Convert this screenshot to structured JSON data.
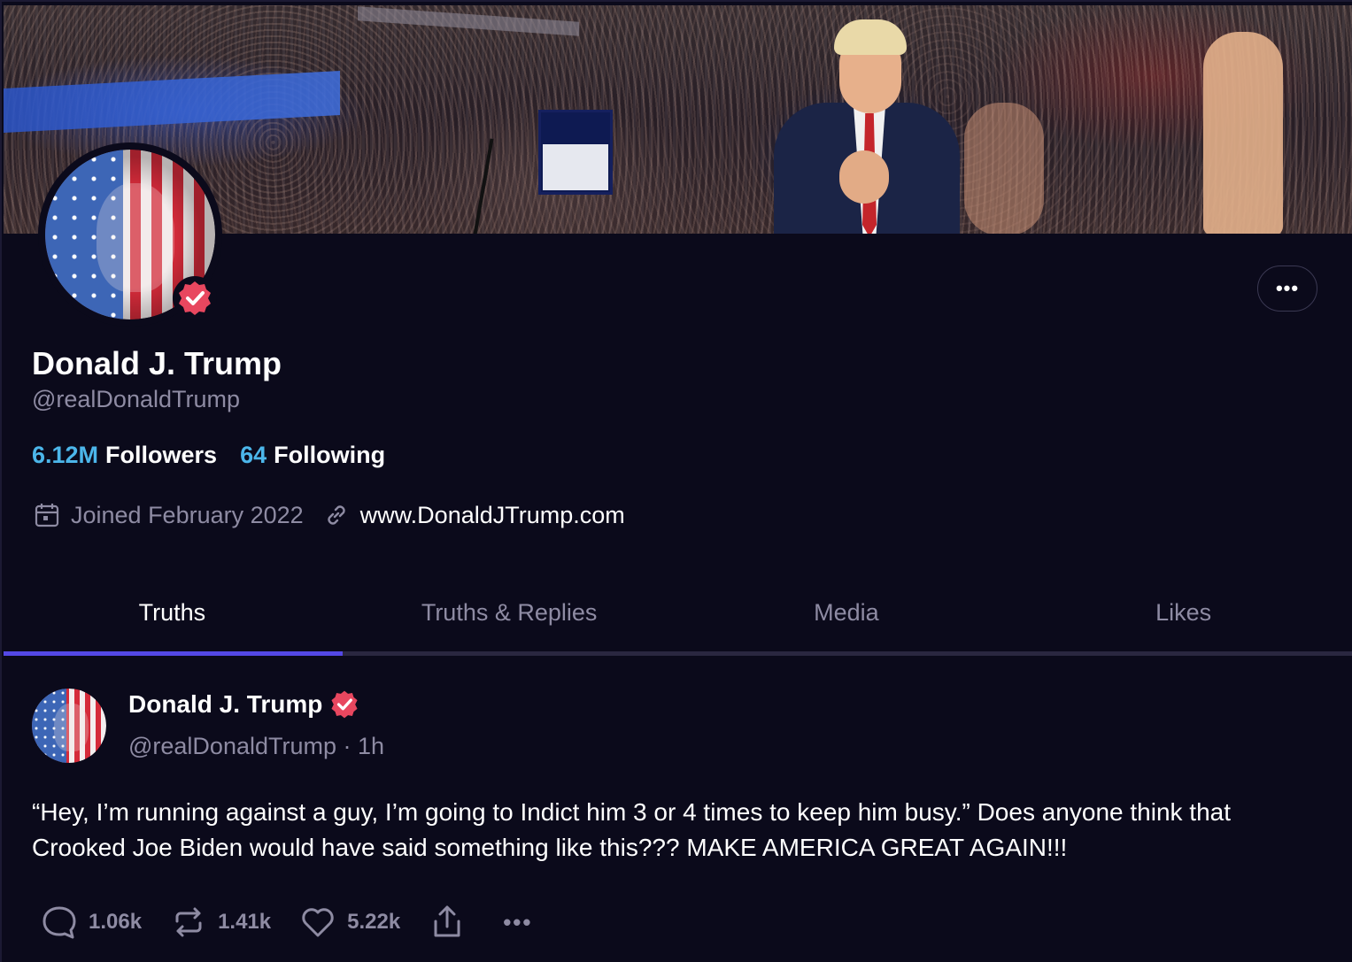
{
  "profile": {
    "name": "Donald J. Trump",
    "handle": "@realDonaldTrump",
    "followers_count": "6.12M",
    "followers_label": "Followers",
    "following_count": "64",
    "following_label": "Following",
    "joined": "Joined February 2022",
    "website": "www.DonaldJTrump.com",
    "more_label": "•••"
  },
  "tabs": [
    {
      "label": "Truths",
      "active": true
    },
    {
      "label": "Truths & Replies",
      "active": false
    },
    {
      "label": "Media",
      "active": false
    },
    {
      "label": "Likes",
      "active": false
    }
  ],
  "post": {
    "author": "Donald J. Trump",
    "handle_time": "@realDonaldTrump · 1h",
    "text": "“Hey, I’m running against a guy, I’m going to Indict him 3 or 4 times to keep him busy.” Does anyone think that Crooked Joe Biden would have said something like this??? MAKE AMERICA GREAT AGAIN!!!",
    "replies": "1.06k",
    "retruths": "1.41k",
    "likes": "5.22k",
    "more_label": "•••"
  },
  "colors": {
    "background": "#0b0a1b",
    "accent_blue": "#4cb6ea",
    "tab_indicator": "#5448e6",
    "verified_badge": "#e8475f",
    "muted_text": "#8e8ba3"
  },
  "icons": {
    "verified": "verified-badge-icon",
    "calendar": "calendar-icon",
    "link": "link-icon",
    "reply": "reply-icon",
    "retruth": "retruth-icon",
    "like": "heart-icon",
    "share": "share-icon",
    "more": "more-icon"
  }
}
